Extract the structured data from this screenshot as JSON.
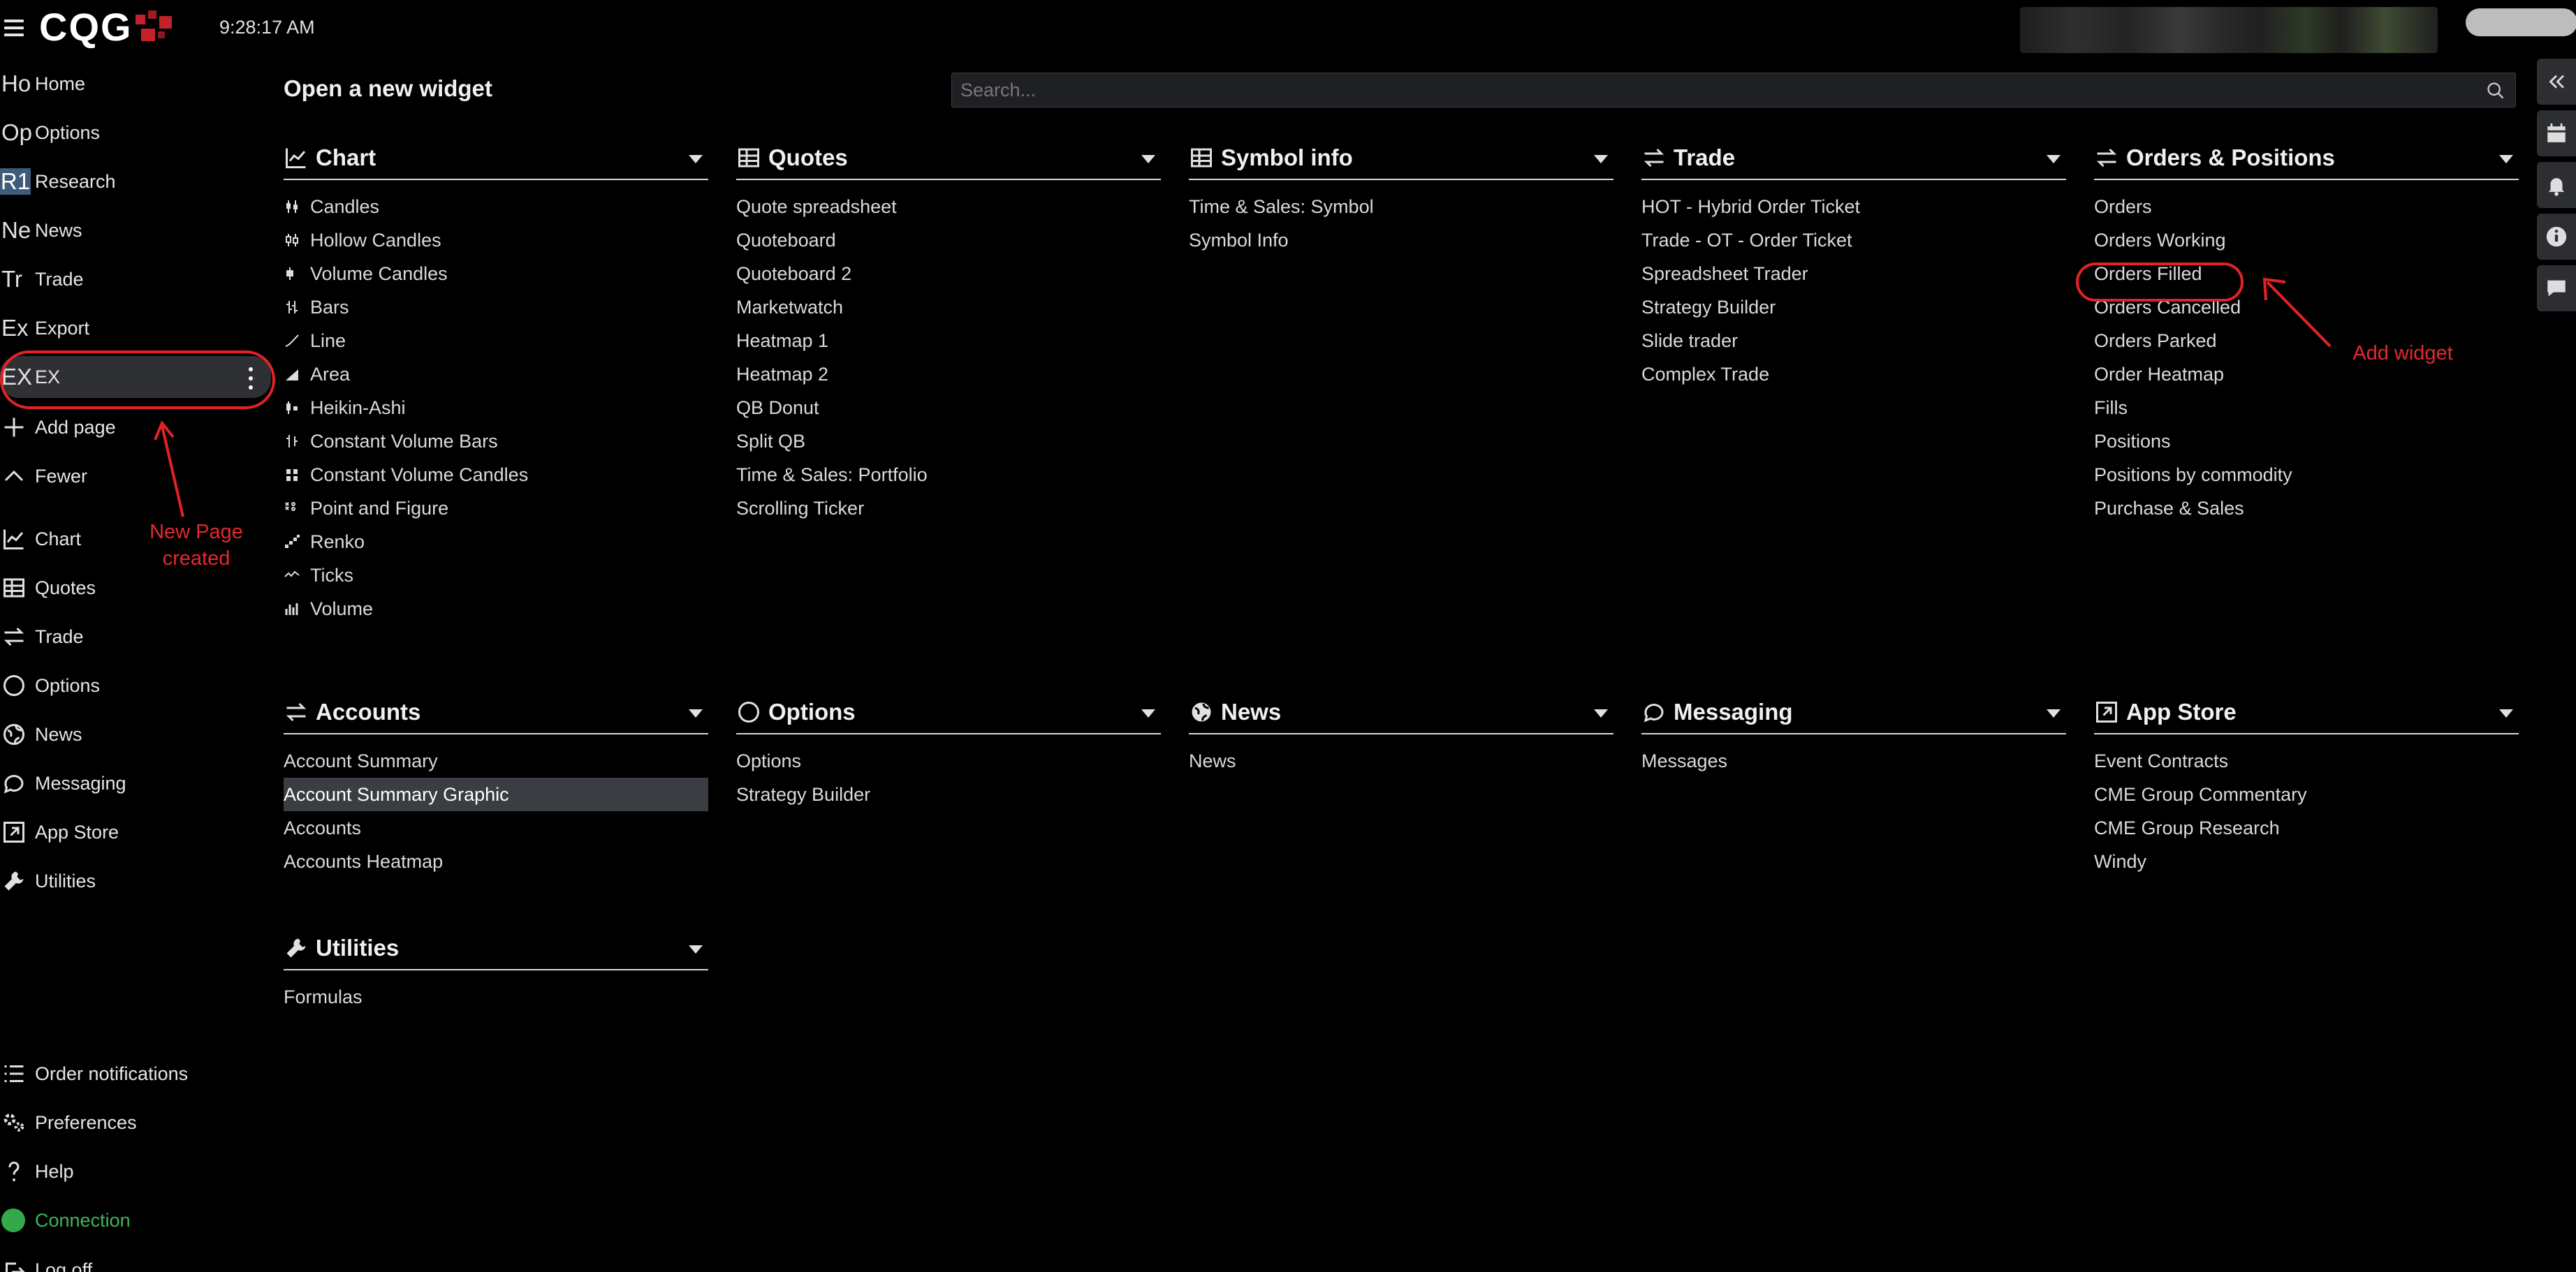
{
  "header": {
    "logo_text": "CQG",
    "time": "9:28:17 AM"
  },
  "sidebar": {
    "pages": [
      {
        "abbr": "Ho",
        "label": "Home"
      },
      {
        "abbr": "Op",
        "label": "Options"
      },
      {
        "abbr": "R1",
        "label": "Research"
      },
      {
        "abbr": "Ne",
        "label": "News"
      },
      {
        "abbr": "Tr",
        "label": "Trade"
      },
      {
        "abbr": "Ex",
        "label": "Export"
      },
      {
        "abbr": "EX",
        "label": "EX"
      }
    ],
    "add_page": "Add page",
    "fewer": "Fewer",
    "widgets": [
      {
        "icon": "chart-line-icon",
        "label": "Chart"
      },
      {
        "icon": "table-icon",
        "label": "Quotes"
      },
      {
        "icon": "swap-arrows-icon",
        "label": "Trade"
      },
      {
        "icon": "circle-icon",
        "label": "Options"
      },
      {
        "icon": "globe-icon",
        "label": "News"
      },
      {
        "icon": "speech-bubble-icon",
        "label": "Messaging"
      },
      {
        "icon": "external-box-icon",
        "label": "App Store"
      },
      {
        "icon": "wrench-icon",
        "label": "Utilities"
      }
    ],
    "bottom": [
      {
        "icon": "list-icon",
        "label": "Order notifications"
      },
      {
        "icon": "gears-icon",
        "label": "Preferences"
      },
      {
        "icon": "question-icon",
        "label": "Help"
      },
      {
        "icon": "status-dot-icon",
        "label": "Connection"
      },
      {
        "icon": "logout-icon",
        "label": "Log off"
      }
    ]
  },
  "annotations": {
    "new_page": "New Page\ncreated",
    "add_widget": "Add widget"
  },
  "main": {
    "title": "Open a new widget",
    "search_placeholder": "Search...",
    "sections": [
      {
        "title": "Chart",
        "items": [
          "Candles",
          "Hollow Candles",
          "Volume Candles",
          "Bars",
          "Line",
          "Area",
          "Heikin-Ashi",
          "Constant Volume Bars",
          "Constant Volume Candles",
          "Point and Figure",
          "Renko",
          "Ticks",
          "Volume"
        ]
      },
      {
        "title": "Quotes",
        "items": [
          "Quote spreadsheet",
          "Quoteboard",
          "Quoteboard 2",
          "Marketwatch",
          "Heatmap 1",
          "Heatmap 2",
          "QB Donut",
          "Split QB",
          "Time & Sales: Portfolio",
          "Scrolling Ticker"
        ]
      },
      {
        "title": "Symbol info",
        "items": [
          "Time & Sales: Symbol",
          "Symbol Info"
        ]
      },
      {
        "title": "Trade",
        "items": [
          "HOT - Hybrid Order Ticket",
          "Trade - OT - Order Ticket",
          "Spreadsheet Trader",
          "Strategy Builder",
          "Slide trader",
          "Complex Trade"
        ]
      },
      {
        "title": "Orders & Positions",
        "items": [
          "Orders",
          "Orders Working",
          "Orders Filled",
          "Orders Cancelled",
          "Orders Parked",
          "Order Heatmap",
          "Fills",
          "Positions",
          "Positions by commodity",
          "Purchase & Sales"
        ]
      },
      {
        "title": "Accounts",
        "items": [
          "Account Summary",
          "Account Summary Graphic",
          "Accounts",
          "Accounts Heatmap"
        ]
      },
      {
        "title": "Options",
        "items": [
          "Options",
          "Strategy Builder"
        ]
      },
      {
        "title": "News",
        "items": [
          "News"
        ]
      },
      {
        "title": "Messaging",
        "items": [
          "Messages"
        ]
      },
      {
        "title": "App Store",
        "items": [
          "Event Contracts",
          "CME Group Commentary",
          "CME Group Research",
          "Windy"
        ]
      },
      {
        "title": "Utilities",
        "items": [
          "Formulas"
        ]
      }
    ]
  },
  "colors": {
    "background": "#000000",
    "accent_red": "#e32226",
    "connection_green": "#35a84c",
    "selected_row": "#3a3d42",
    "research_badge": "#3f5b7a"
  }
}
